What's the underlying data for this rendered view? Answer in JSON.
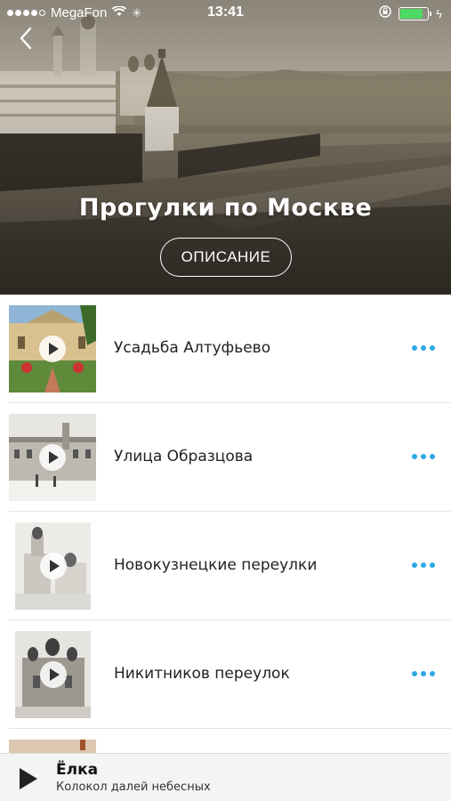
{
  "status_bar": {
    "carrier": "MegaFon",
    "time": "13:41",
    "battery_color": "#4cd964",
    "battery_level": 0.85
  },
  "header": {
    "title": "Прогулки по Москве",
    "description_button": "ОПИСАНИЕ",
    "back_icon": "chevron-left-icon"
  },
  "list": {
    "accent_color": "#2ea8e6",
    "items": [
      {
        "title": "Усадьба Алтуфьево"
      },
      {
        "title": "Улица Образцова"
      },
      {
        "title": "Новокузнецкие переулки"
      },
      {
        "title": "Никитников переулок"
      }
    ]
  },
  "player": {
    "title": "Ёлка",
    "subtitle": "Колокол далей небесных"
  }
}
